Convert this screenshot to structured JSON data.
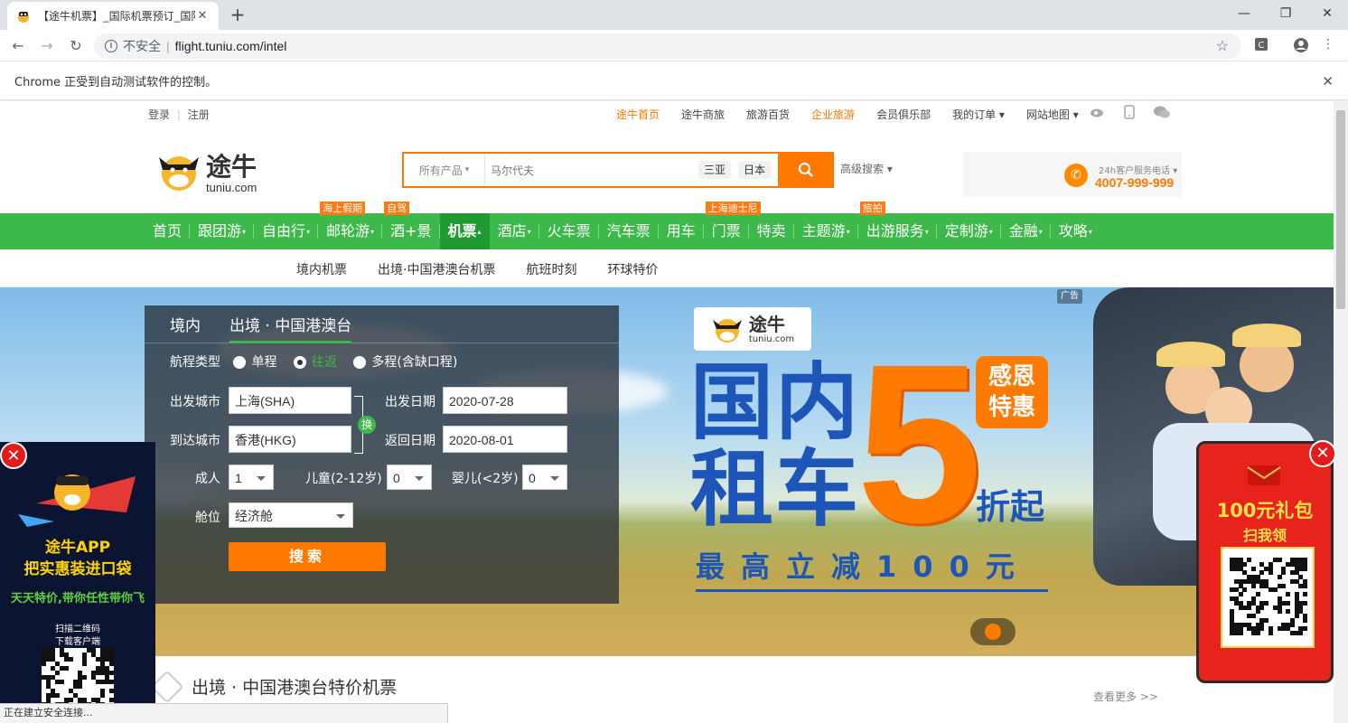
{
  "browser": {
    "tab_title": "【途牛机票】_国际机票预订_国际",
    "url_prefix": "不安全",
    "url_sep": "|",
    "url": "flight.tuniu.com/intel",
    "infobar": "Chrome 正受到自动测试软件的控制。",
    "status": "正在建立安全连接..."
  },
  "topbar": {
    "login": "登录",
    "divider": "|",
    "register": "注册",
    "links": [
      "途牛首页",
      "途牛商旅",
      "旅游百货",
      "企业旅游",
      "会员俱乐部",
      "我的订单 ▾",
      "网站地图 ▾"
    ]
  },
  "header": {
    "logo_cn": "途牛",
    "logo_en": "tuniu.com",
    "search_category": "所有产品",
    "search_placeholder": "马尔代夫",
    "hot_tags": [
      "三亚",
      "日本"
    ],
    "advanced": "高级搜索 ▾",
    "hotline_label": "24h客户服务电话 ▾",
    "hotline_number": "4007-999-999"
  },
  "nav": {
    "items": [
      {
        "label": "首页",
        "arrow": "",
        "tag": ""
      },
      {
        "label": "跟团游",
        "arrow": "▾",
        "tag": ""
      },
      {
        "label": "自由行",
        "arrow": "▾",
        "tag": ""
      },
      {
        "label": "邮轮游",
        "arrow": "▾",
        "tag": "海上假期"
      },
      {
        "label": "酒+景",
        "arrow": "",
        "tag": "自驾"
      },
      {
        "label": "机票",
        "arrow": "▴",
        "tag": ""
      },
      {
        "label": "酒店",
        "arrow": "▾",
        "tag": ""
      },
      {
        "label": "火车票",
        "arrow": "",
        "tag": ""
      },
      {
        "label": "汽车票",
        "arrow": "",
        "tag": ""
      },
      {
        "label": "用车",
        "arrow": "",
        "tag": ""
      },
      {
        "label": "门票",
        "arrow": "",
        "tag": "上海迪士尼"
      },
      {
        "label": "特卖",
        "arrow": "",
        "tag": ""
      },
      {
        "label": "主题游",
        "arrow": "▾",
        "tag": ""
      },
      {
        "label": "出游服务",
        "arrow": "▾",
        "tag": "旅拍"
      },
      {
        "label": "定制游",
        "arrow": "▾",
        "tag": ""
      },
      {
        "label": "金融",
        "arrow": "▾",
        "tag": ""
      },
      {
        "label": "攻略",
        "arrow": "▾",
        "tag": ""
      }
    ],
    "sub": [
      "境内机票",
      "出境·中国港澳台机票",
      "航班时刻",
      "环球特价"
    ]
  },
  "banner": {
    "adtag": "广告",
    "logo_cn": "途牛",
    "logo_en": "tuniu.com",
    "line1": "国内",
    "line2": "租车",
    "five": "5",
    "bubble1": "感恩",
    "bubble2": "特惠",
    "zhe": "折起",
    "sub": "最高立减100元"
  },
  "flight": {
    "tab_domestic": "境内",
    "tab_intl": "出境 · 中国港澳台",
    "trip_type_label": "航程类型",
    "trip_types": [
      "单程",
      "往返",
      "多程(含缺口程)"
    ],
    "depart_city_label": "出发城市",
    "depart_city": "上海(SHA)",
    "arrive_city_label": "到达城市",
    "arrive_city": "香港(HKG)",
    "swap": "换",
    "depart_date_label": "出发日期",
    "depart_date": "2020-07-28",
    "return_date_label": "返回日期",
    "return_date": "2020-08-01",
    "adult_label": "成人",
    "adult": "1",
    "child_label": "儿童(2-12岁)",
    "child": "0",
    "infant_label": "婴儿(<2岁)",
    "infant": "0",
    "cabin_label": "舱位",
    "cabin": "经济舱",
    "search": "搜索"
  },
  "section": {
    "title": "出境 · 中国港澳台特价机票",
    "more": "查看更多 >>"
  },
  "left_ad": {
    "line1": "途牛APP",
    "line2": "把实惠装进口袋",
    "line3": "天天特价,带你任性带你飞",
    "line4": "扫描二维码",
    "line5": "下载客户端",
    "close": "✕"
  },
  "right_ad": {
    "line1": "100元礼包",
    "line2": "扫我领",
    "close": "✕"
  },
  "colors": {
    "brand_orange": "#ff7800",
    "nav_green": "#3db84a",
    "banner_blue": "#1d56b8"
  }
}
